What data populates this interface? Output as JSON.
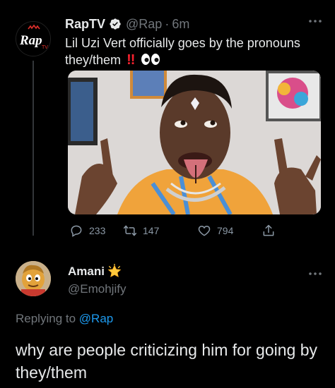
{
  "tweet": {
    "display_name": "RapTV",
    "handle": "@Rap",
    "separator": "·",
    "time": "6m",
    "text": "Lil Uzi Vert officially goes by the pronouns they/them",
    "emphasis": "!!",
    "avatar_logo": "Rap",
    "avatar_sub": "TV",
    "stats": {
      "replies": "233",
      "retweets": "147",
      "likes": "794"
    },
    "icons": [
      "verified-badge-icon",
      "more-icon",
      "reply-icon",
      "retweet-icon",
      "like-icon",
      "share-icon",
      "eyes-emoji-icon"
    ]
  },
  "reply": {
    "display_name": "Amani",
    "handle": "@Emohjify",
    "replying_prefix": "Replying to",
    "replying_to": "@Rap",
    "text": "why are people criticizing him for going by they/them",
    "icons": [
      "star-emoji-icon",
      "more-icon"
    ]
  },
  "colors": {
    "background": "#000000",
    "primary_text": "#e7e9ea",
    "secondary_text": "#71767b",
    "link": "#1d9bf0",
    "verified": "#1d9bf0",
    "accent_red": "#f4212e"
  }
}
